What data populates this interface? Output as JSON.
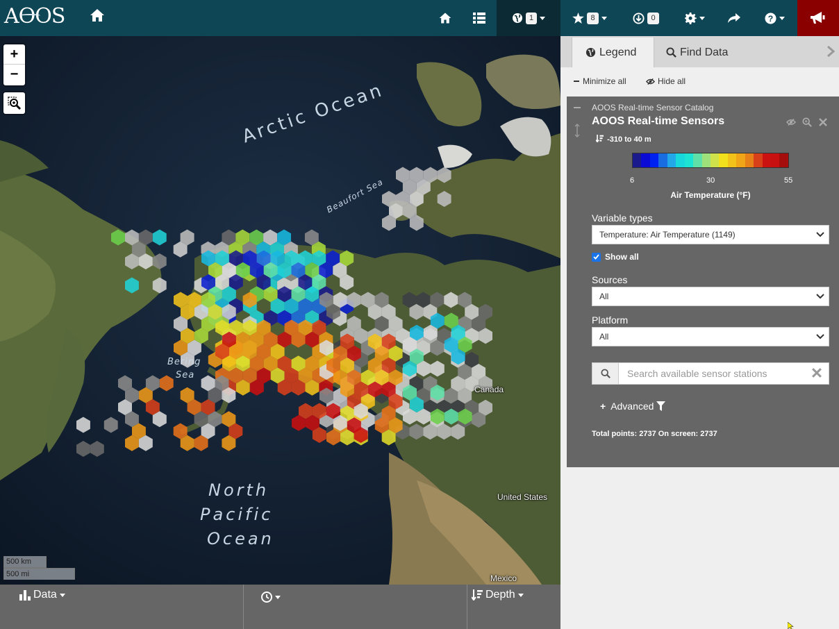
{
  "navbar": {
    "logo_text": "AOOS",
    "layers_badge": "1",
    "favorites_badge": "8",
    "downloads_badge": "0",
    "icons": [
      "home-icon",
      "home-icon",
      "list-icon",
      "globe-icon",
      "star-icon",
      "download-icon",
      "gear-icon",
      "share-icon",
      "question-icon",
      "megaphone-icon"
    ]
  },
  "map": {
    "labels": {
      "arctic_ocean": "Arctic Ocean",
      "beaufort_sea": "Beaufort Sea",
      "bering_sea_1": "Bering",
      "bering_sea_2": "Sea",
      "north_pacific_1": "North",
      "north_pacific_2": "Pacific",
      "north_pacific_3": "Ocean",
      "canada": "Canada",
      "united_states": "United States",
      "mexico": "Mexico"
    },
    "scale_km": "500 km",
    "scale_mi": "500 mi",
    "zoom_in": "+",
    "zoom_out": "−"
  },
  "bottom_bar": {
    "data_label": "Data",
    "depth_label": "Depth"
  },
  "side_panel": {
    "tabs": {
      "legend": "Legend",
      "find_data": "Find Data"
    },
    "actions": {
      "minimize_all": "Minimize all",
      "hide_all": "Hide all"
    },
    "layer": {
      "subtitle": "AOOS Real-time Sensor Catalog",
      "title": "AOOS Real-time Sensors",
      "depth_range": "-310 to 40 m",
      "colorbar": {
        "min": "6",
        "mid": "30",
        "max": "55",
        "label": "Air Temperature (°F)",
        "colors": [
          "#1a1a8c",
          "#0b0bd6",
          "#0022f0",
          "#1a6de0",
          "#22a8e8",
          "#19d8dc",
          "#1de3d3",
          "#5ee0a8",
          "#9ee07a",
          "#cfe24c",
          "#f2e01c",
          "#f3c21a",
          "#f0a418",
          "#e8801a",
          "#d8401a",
          "#cc1111",
          "#c81010",
          "#a50c0c"
        ]
      },
      "variable_types_label": "Variable types",
      "variable_types_value": "Temperature: Air Temperature (1149)",
      "show_all_label": "Show all",
      "show_all_checked": true,
      "sources_label": "Sources",
      "sources_value": "All",
      "platform_label": "Platform",
      "platform_value": "All",
      "search_placeholder": "Search available sensor stations",
      "advanced_label": "Advanced",
      "totals": "Total points: 2737 On screen: 2737"
    }
  }
}
